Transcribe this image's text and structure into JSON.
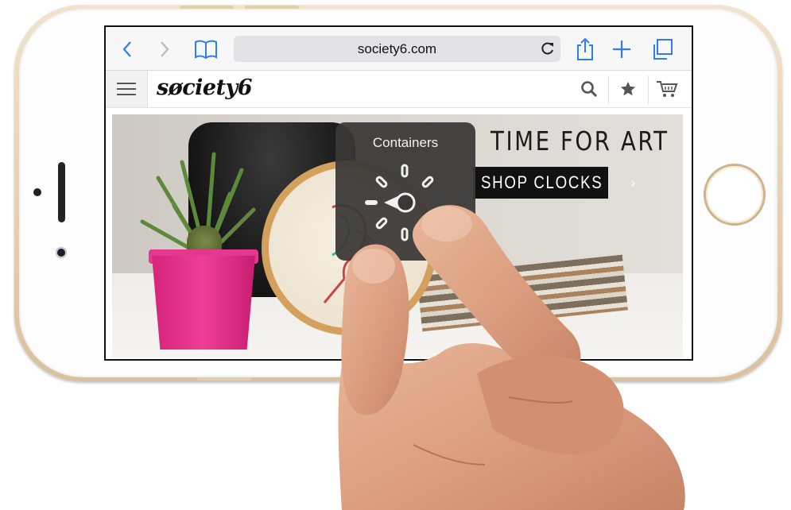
{
  "browser": {
    "back_icon": "chevron-left-icon",
    "forward_icon": "chevron-right-icon",
    "bookmarks_icon": "book-icon",
    "url": "society6.com",
    "reload_icon": "reload-icon",
    "share_icon": "share-icon",
    "new_tab_icon": "plus-icon",
    "tabs_icon": "tabs-icon",
    "accent_color": "#2f7cf6"
  },
  "site": {
    "menu_icon": "hamburger-menu-icon",
    "logo": "søciety6",
    "search_icon": "search-icon",
    "favorites_icon": "star-icon",
    "cart_icon": "cart-icon"
  },
  "hero": {
    "headline": "TIME FOR ART",
    "cta_label": "SHOP CLOCKS",
    "cta_arrow": "›"
  },
  "popup": {
    "title": "Containers",
    "dial_icon": "rotor-dial-icon"
  }
}
